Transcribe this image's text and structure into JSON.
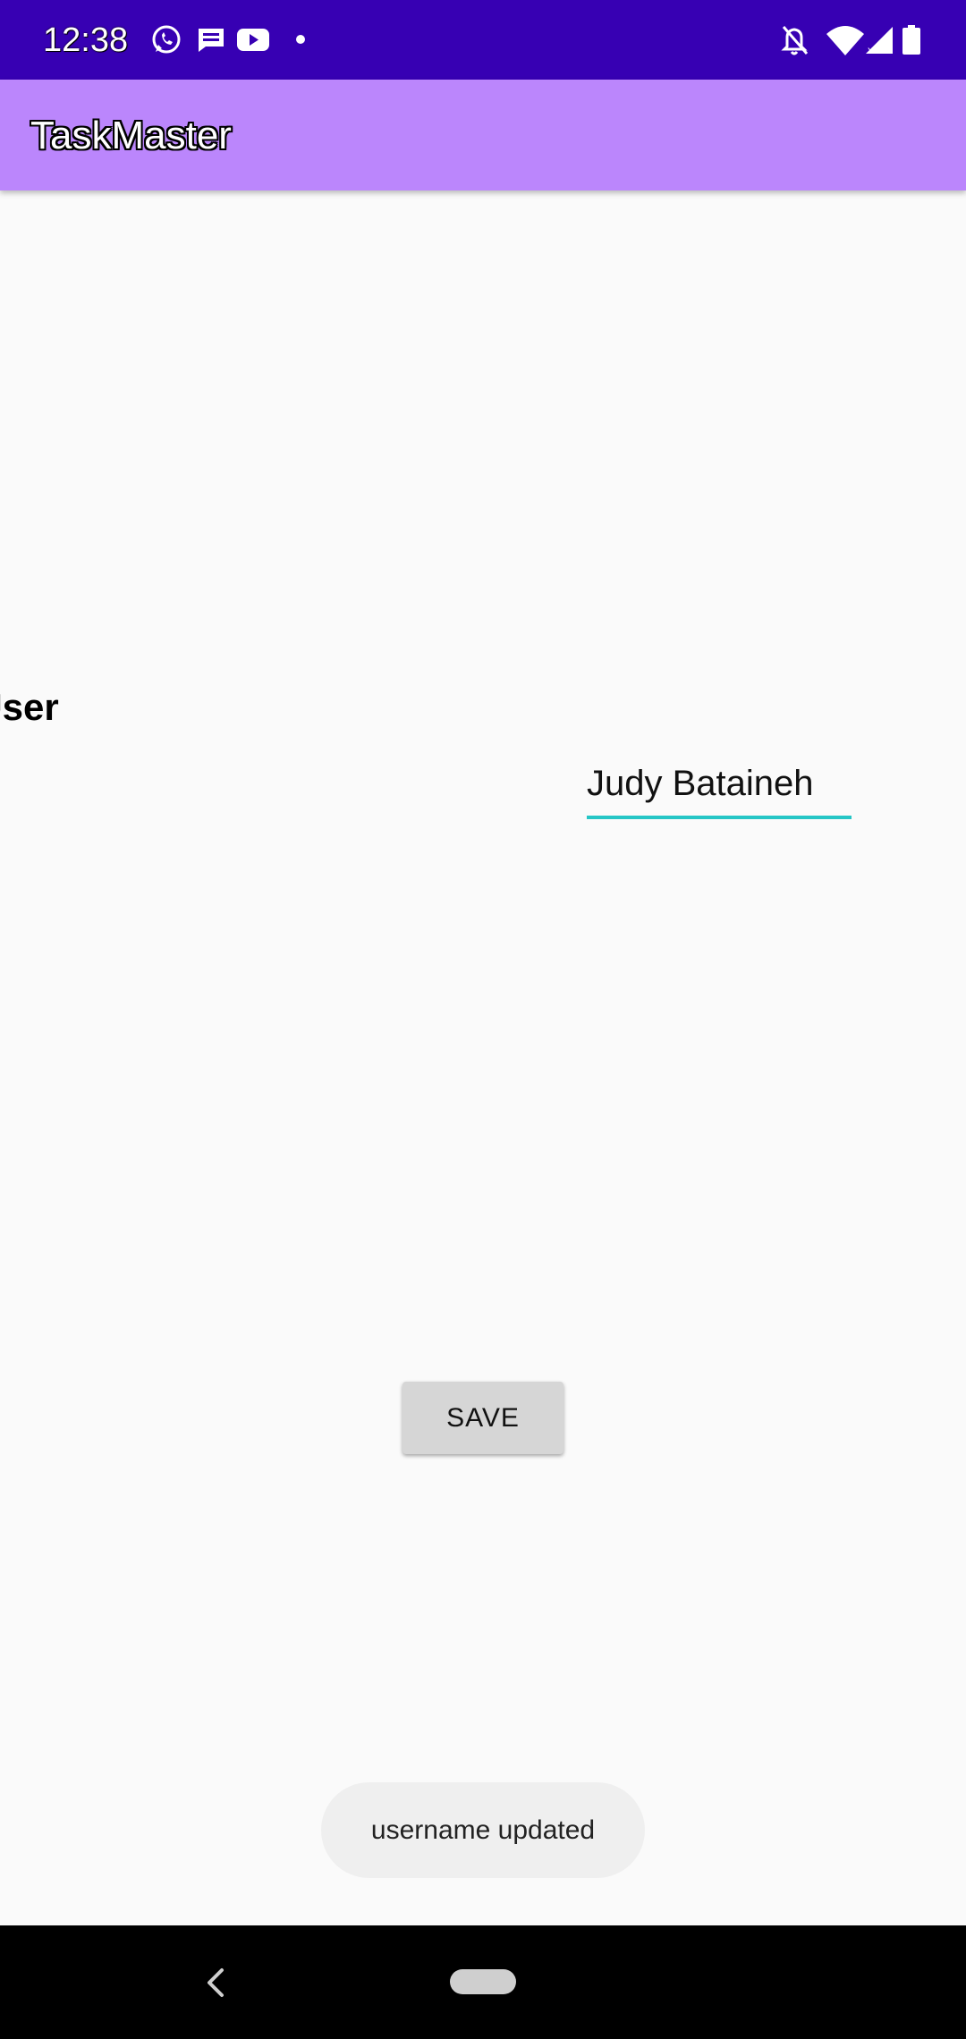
{
  "status_bar": {
    "time": "12:38",
    "left_icons": [
      "whatsapp-icon",
      "message-icon",
      "youtube-icon",
      "notification-dot-icon"
    ],
    "right_icons": [
      "notifications-off-icon",
      "wifi-icon",
      "signal-icon",
      "battery-icon"
    ],
    "background": "#3700b3"
  },
  "app_bar": {
    "title": "TaskMaster",
    "background": "#bb86fc"
  },
  "form": {
    "label": "w User\nme",
    "username_value": "Judy Bataineh",
    "field_accent": "#26c6c6",
    "save_label": "SAVE"
  },
  "toast": {
    "message": "username updated"
  },
  "nav_bar": {
    "icons": [
      "back-icon",
      "home-pill-icon"
    ]
  }
}
